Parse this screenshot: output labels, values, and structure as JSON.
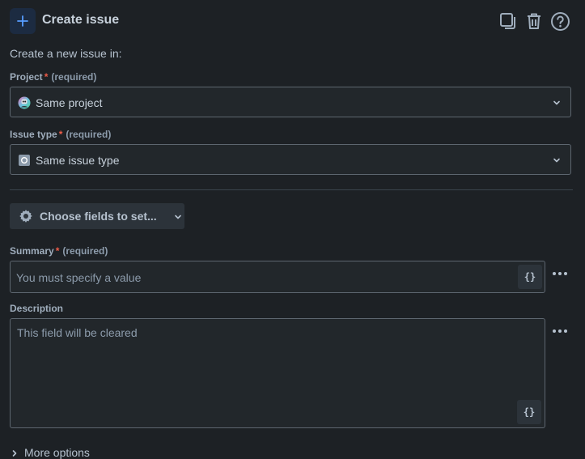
{
  "header": {
    "title": "Create issue",
    "icon": "plus-icon",
    "actions": [
      "copy-icon",
      "trash-icon",
      "help-icon"
    ]
  },
  "subtitle": "Create a new issue in:",
  "project": {
    "label": "Project",
    "required_star": "*",
    "required_text": "(required)",
    "value": "Same project"
  },
  "issue_type": {
    "label": "Issue type",
    "required_star": "*",
    "required_text": "(required)",
    "value": "Same issue type"
  },
  "choose_fields": {
    "label": "Choose fields to set..."
  },
  "summary": {
    "label": "Summary",
    "required_star": "*",
    "required_text": "(required)",
    "placeholder": "You must specify a value",
    "smart_value": "{}"
  },
  "description": {
    "label": "Description",
    "placeholder": "This field will be cleared",
    "smart_value": "{}"
  },
  "more_options": {
    "label": "More options"
  },
  "colors": {
    "background": "#1d2125",
    "accent": "#579dff",
    "required": "#ef5c48"
  }
}
